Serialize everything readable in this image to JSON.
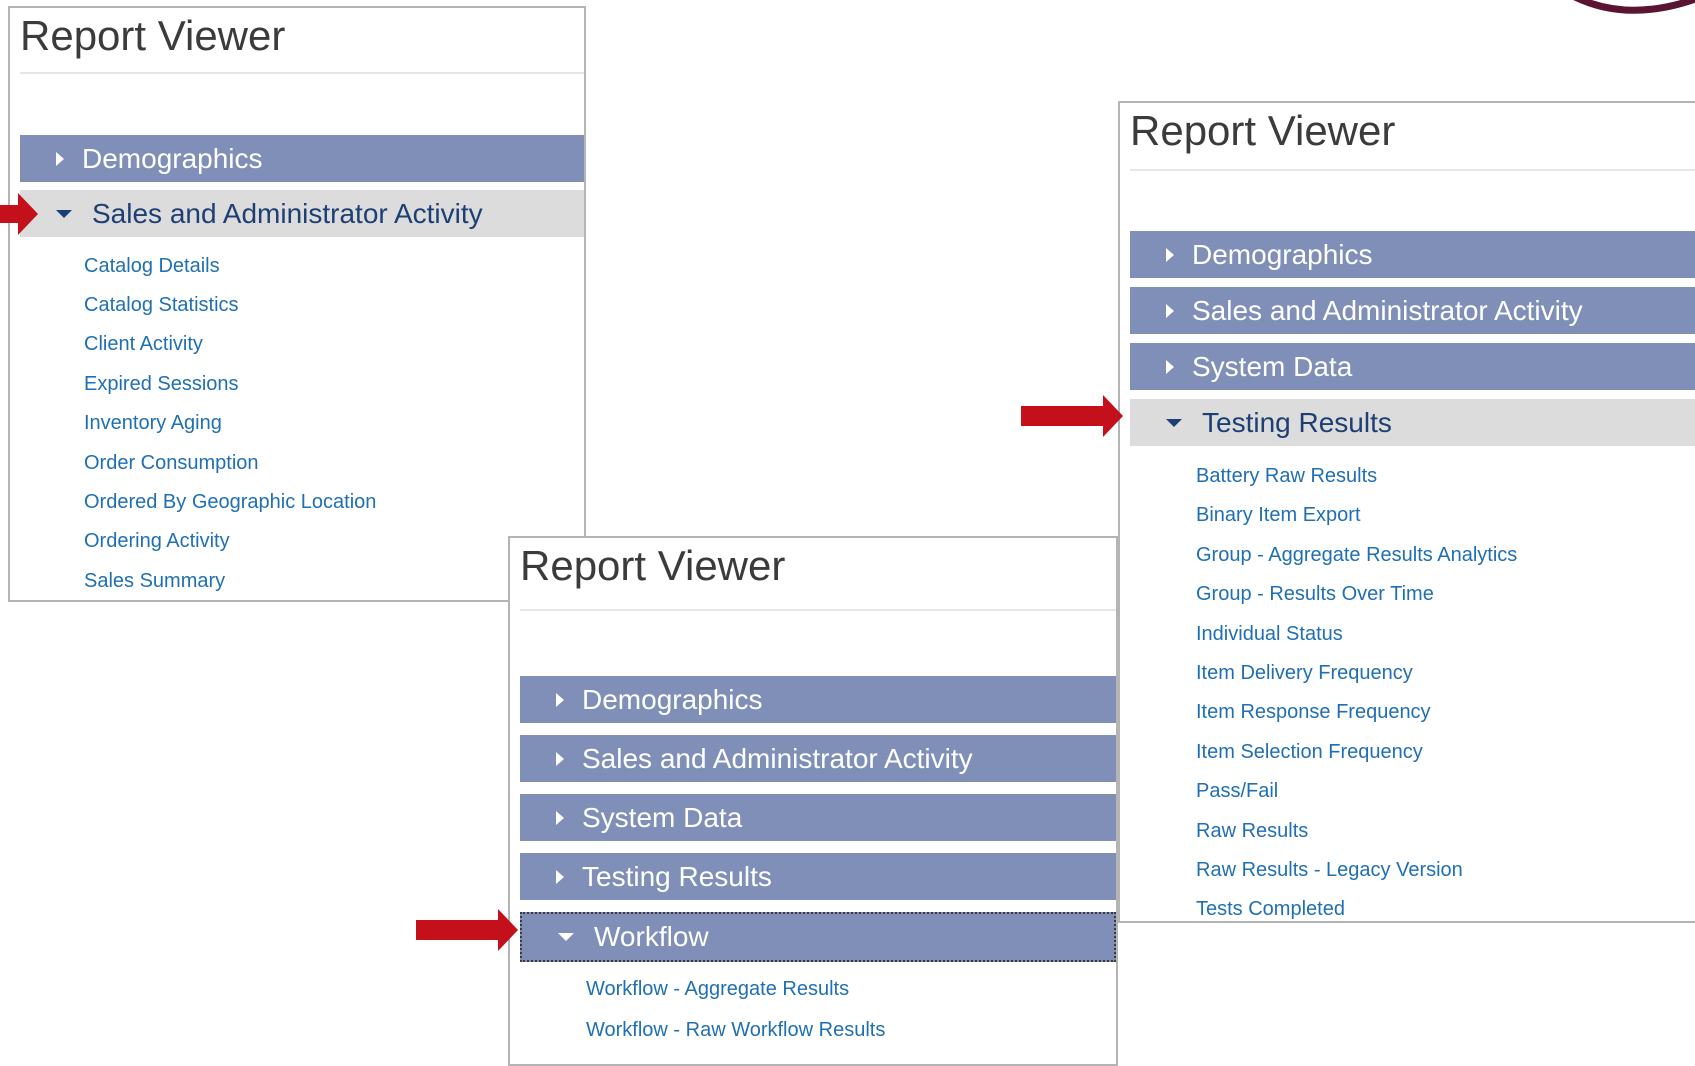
{
  "panels": [
    {
      "title": "Report Viewer",
      "sections": [
        {
          "label": "Demographics",
          "state": "collapsed"
        },
        {
          "label": "Sales and Administrator Activity",
          "state": "expanded"
        }
      ],
      "sub_items": [
        "Catalog Details",
        "Catalog Statistics",
        "Client Activity",
        "Expired Sessions",
        "Inventory Aging",
        "Order Consumption",
        "Ordered By Geographic Location",
        "Ordering Activity",
        "Sales Summary"
      ]
    },
    {
      "title": "Report Viewer",
      "sections": [
        {
          "label": "Demographics",
          "state": "collapsed"
        },
        {
          "label": "Sales and Administrator Activity",
          "state": "collapsed"
        },
        {
          "label": "System Data",
          "state": "collapsed"
        },
        {
          "label": "Testing Results",
          "state": "collapsed"
        },
        {
          "label": "Workflow",
          "state": "expanded"
        }
      ],
      "sub_items": [
        "Workflow - Aggregate Results",
        "Workflow - Raw Workflow Results"
      ]
    },
    {
      "title": "Report Viewer",
      "sections": [
        {
          "label": "Demographics",
          "state": "collapsed"
        },
        {
          "label": "Sales and Administrator Activity",
          "state": "collapsed"
        },
        {
          "label": "System Data",
          "state": "collapsed"
        },
        {
          "label": "Testing Results",
          "state": "expanded"
        }
      ],
      "sub_items": [
        "Battery Raw Results",
        "Binary Item Export",
        "Group - Aggregate Results Analytics",
        "Group - Results Over Time",
        "Individual Status",
        "Item Delivery Frequency",
        "Item Response Frequency",
        "Item Selection Frequency",
        "Pass/Fail",
        "Raw Results",
        "Raw Results - Legacy Version",
        "Tests Completed"
      ]
    }
  ],
  "icons": {
    "section_collapsed": "caret-right-icon",
    "section_expanded": "caret-down-icon",
    "pointer": "red-arrow-icon"
  },
  "colors": {
    "section_bar": "#7f8fb7",
    "section_expanded_bar": "#dcdcdc",
    "link": "#1f6fb4",
    "expanded_text": "#1d3f73",
    "arrow": "#c3101b",
    "logo": "#5a1530"
  }
}
